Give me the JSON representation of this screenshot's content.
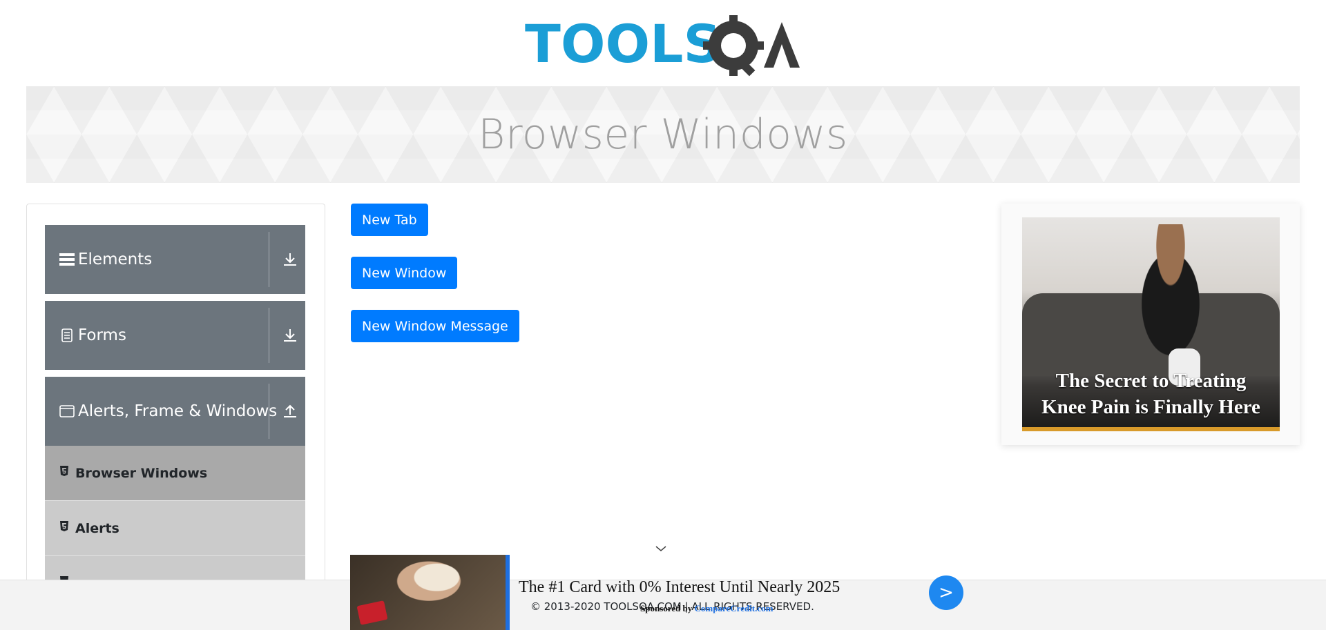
{
  "header": {
    "logo_text": "TOOLSQA",
    "logo_icon": "gear-magnifier-icon",
    "colors": {
      "logo_blue": "#1b9ed6",
      "logo_dark": "#3c3c3c"
    }
  },
  "banner": {
    "title": "Browser Windows"
  },
  "sidebar": {
    "groups": [
      {
        "label": "Elements",
        "icon": "hamburger-icon",
        "arrow": "download-arrow-icon"
      },
      {
        "label": "Forms",
        "icon": "document-icon",
        "arrow": "download-arrow-icon"
      },
      {
        "label": "Alerts, Frame & Windows",
        "icon": "window-icon",
        "arrow": "upload-arrow-icon"
      }
    ],
    "items": [
      {
        "label": "Browser Windows",
        "icon": "html5-icon",
        "active": true
      },
      {
        "label": "Alerts",
        "icon": "html5-icon",
        "active": false
      }
    ]
  },
  "buttons": {
    "new_tab": "New Tab",
    "new_window": "New Window",
    "new_window_message": "New Window Message"
  },
  "right_ad": {
    "caption_line1": "The Secret to Treating",
    "caption_line2": "Knee Pain is Finally Here"
  },
  "bottom_ad": {
    "headline": "The #1 Card with 0% Interest Until Nearly 2025",
    "sponsored_prefix": "Sponsored by",
    "sponsor_name": "CompareCredit.com",
    "go_label": ">"
  },
  "footer": {
    "text": "© 2013-2020 TOOLSQA.COM | ALL RIGHTS RESERVED."
  },
  "colors": {
    "primary_button": "#007bff",
    "sidebar_group": "#6c757d",
    "submenu_active": "#a9a9a9",
    "submenu": "#cbcbcb"
  }
}
